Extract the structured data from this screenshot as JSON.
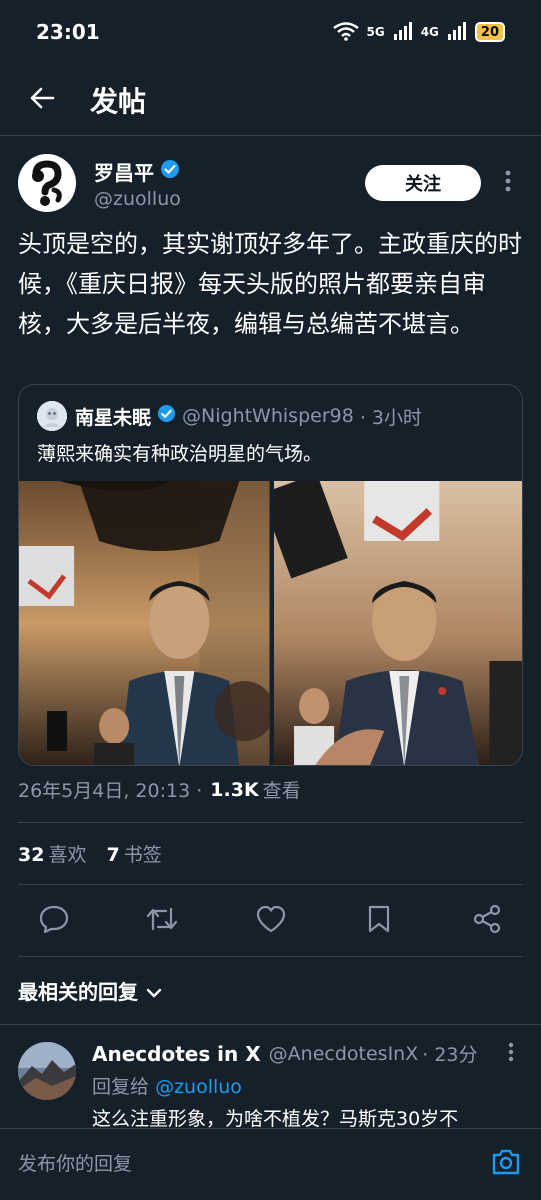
{
  "status_bar": {
    "time": "23:01",
    "network_1": "6",
    "network_2": "5G",
    "network_3": "4G",
    "battery": "20"
  },
  "header": {
    "title": "发帖",
    "back_icon": "arrow-left-icon"
  },
  "post": {
    "author_name": "罗昌平",
    "author_handle": "@zuolluo",
    "verified": true,
    "follow_label": "关注",
    "text": "头顶是空的，其实谢顶好多年了。主政重庆的时候，《重庆日报》每天头版的照片都要亲自审核，大多是后半夜，编辑与总编苦不堪言。",
    "quote": {
      "author_name": "南星未眠",
      "author_handle": "@NightWhisper98",
      "time": "· 3小时",
      "text": "薄熙来确实有种政治明星的气场。"
    },
    "meta": {
      "date": "26年5月4日, 20:13 ·",
      "views_num": "1.3K",
      "views_label": "查看"
    },
    "stats": {
      "likes_num": "32",
      "likes_label": "喜欢",
      "bookmarks_num": "7",
      "bookmarks_label": "书签"
    }
  },
  "actions": [
    "reply-icon",
    "repost-icon",
    "like-icon",
    "bookmark-icon",
    "share-icon"
  ],
  "replies_sort": {
    "label": "最相关的回复"
  },
  "reply": {
    "author_name": "Anecdotes in X",
    "author_handle": "@AnecdotesInX",
    "time": "· 23分",
    "reply_to_label": "回复给",
    "reply_to_handle": "@zuolluo",
    "text": "这么注重形象，为啥不植发？马斯克30岁不"
  },
  "compose": {
    "placeholder": "发布你的回复"
  },
  "colors": {
    "background": "#15202b",
    "accent": "#1d9bf0",
    "muted": "#8b98a5",
    "border": "#38444d"
  }
}
